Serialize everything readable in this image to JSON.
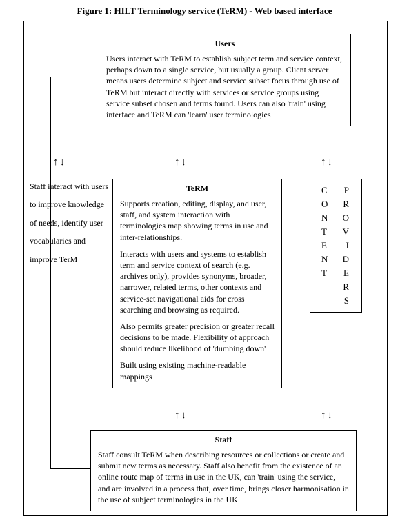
{
  "caption": "Figure 1: HILT Terminology service (TeRM) - Web based interface",
  "users": {
    "title": "Users",
    "body": "Users interact with TeRM to establish subject term and service context, perhaps down to a single service, but usually a group. Client server means users determine subject and service subset focus through use of TeRM but interact directly with services or service groups using service subset chosen and terms found. Users can also 'train' using interface and TeRM can 'learn' user terminologies"
  },
  "term": {
    "title": "TeRM",
    "p1": "Supports creation, editing, display, and user, staff, and system interaction with terminologies map showing terms in use and inter-relationships.",
    "p2": "Interacts with users and systems to establish term and service context of search (e.g. archives only), provides synonyms, broader, narrower, related terms, other contexts and service-set navigational aids for cross searching and browsing as required.",
    "p3": "Also permits greater precision or greater recall decisions to be made. Flexibility of approach should reduce likelihood of 'dumbing down'",
    "p4": "Built using existing machine-readable mappings"
  },
  "content_providers": {
    "left_col": [
      "C",
      "O",
      "N",
      "T",
      "E",
      "N",
      "T"
    ],
    "right_col": [
      "P",
      "R",
      "O",
      "V",
      "I",
      "D",
      "E",
      "R",
      "S"
    ]
  },
  "staff": {
    "title": "Staff",
    "body": "Staff consult TeRM when describing resources or collections or create and submit new terms as necessary. Staff also benefit from the existence of an online route map of terms in use in the UK, can 'train' using the service, and are involved in a process that, over time, brings closer harmonisation in the use of subject terminologies in the UK"
  },
  "side_text": "Staff interact with users to improve knowledge of needs, identify user vocabularies and improve TerM",
  "arrows": {
    "a1": "↑↓",
    "a2": "↑↓",
    "a3": "↑↓",
    "a4": "↑↓",
    "a5": "↑↓"
  }
}
